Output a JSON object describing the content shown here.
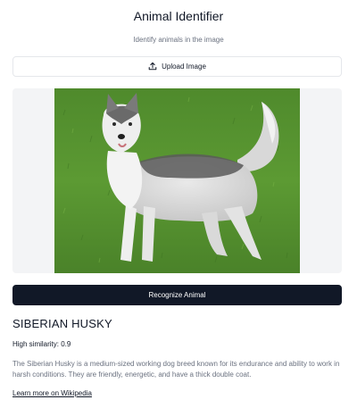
{
  "header": {
    "title": "Animal Identifier",
    "subtitle": "Identify animals in the image"
  },
  "upload": {
    "label": "Upload Image",
    "icon": "upload-icon"
  },
  "image": {
    "alt": "Siberian Husky standing on grass"
  },
  "actions": {
    "recognize_label": "Recognize Animal"
  },
  "result": {
    "name": "SIBERIAN HUSKY",
    "similarity": "High similarity: 0.9",
    "description": "The Siberian Husky is a medium-sized working dog breed known for its endurance and ability to work in harsh conditions. They are friendly, energetic, and have a thick double coat.",
    "link_text": "Learn more on Wikipedia"
  },
  "colors": {
    "primary_button": "#111827",
    "panel_background": "#f3f4f6",
    "muted_text": "#6b7280"
  }
}
